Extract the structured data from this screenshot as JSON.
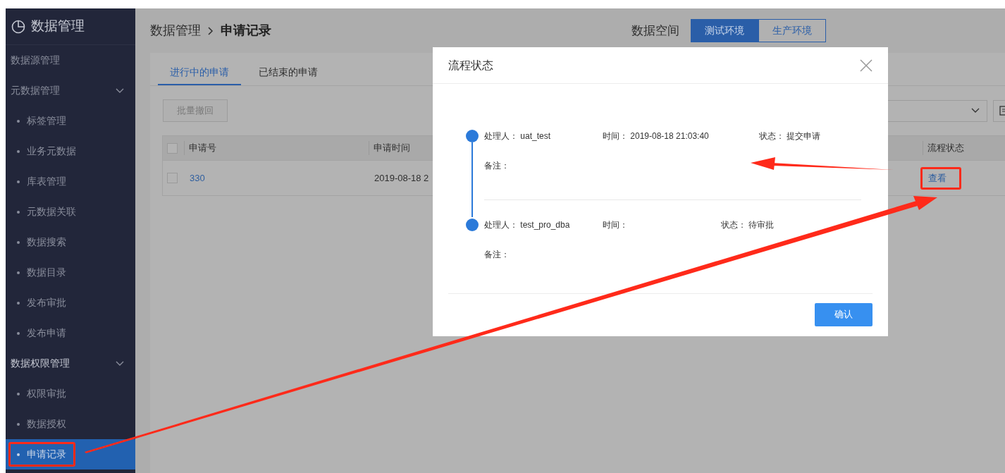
{
  "app": {
    "title": "数据管理"
  },
  "sidebar": {
    "items": [
      {
        "label": "数据源管理",
        "selected": false
      },
      {
        "label": "元数据管理",
        "expanded": true,
        "children": [
          {
            "label": "标签管理",
            "selected": false
          },
          {
            "label": "业务元数据",
            "selected": false
          },
          {
            "label": "库表管理",
            "selected": false
          },
          {
            "label": "元数据关联",
            "selected": false
          },
          {
            "label": "数据搜索",
            "selected": false
          },
          {
            "label": "数据目录",
            "selected": false
          },
          {
            "label": "发布审批",
            "selected": false
          },
          {
            "label": "发布申请",
            "selected": false
          }
        ]
      },
      {
        "label": "数据权限管理",
        "expanded": true,
        "children": [
          {
            "label": "权限审批",
            "selected": false
          },
          {
            "label": "数据授权",
            "selected": false
          },
          {
            "label": "申请记录",
            "selected": true
          }
        ]
      }
    ]
  },
  "header": {
    "breadcrumb": [
      "数据管理",
      "申请记录"
    ],
    "space_label": "数据空间",
    "environments": [
      {
        "label": "测试环境",
        "selected": true
      },
      {
        "label": "生产环境",
        "selected": false
      }
    ]
  },
  "tabs": [
    {
      "label": "进行中的申请",
      "selected": true
    },
    {
      "label": "已结束的申请",
      "selected": false
    }
  ],
  "toolbar": {
    "batch_button": "批量撤回"
  },
  "table": {
    "select_all_checked": false,
    "columns": [
      "申请号",
      "申请时间",
      "流程状态"
    ],
    "rows": [
      {
        "checked": false,
        "id": "330",
        "time": "2019-08-18 2",
        "action": "查看"
      }
    ]
  },
  "dialog": {
    "title": "流程状态",
    "steps": [
      {
        "handler_label": "处理人：",
        "handler": "uat_test",
        "time_label": "时间：",
        "time": "2019-08-18 21:03:40",
        "status_label": "状态：",
        "status": "提交申请",
        "note_label": "备注："
      },
      {
        "handler_label": "处理人：",
        "handler": "test_pro_dba",
        "time_label": "时间：",
        "status_label": "状态：",
        "status": "待审批",
        "note_label": "备注："
      }
    ],
    "confirm_button": "确认"
  }
}
